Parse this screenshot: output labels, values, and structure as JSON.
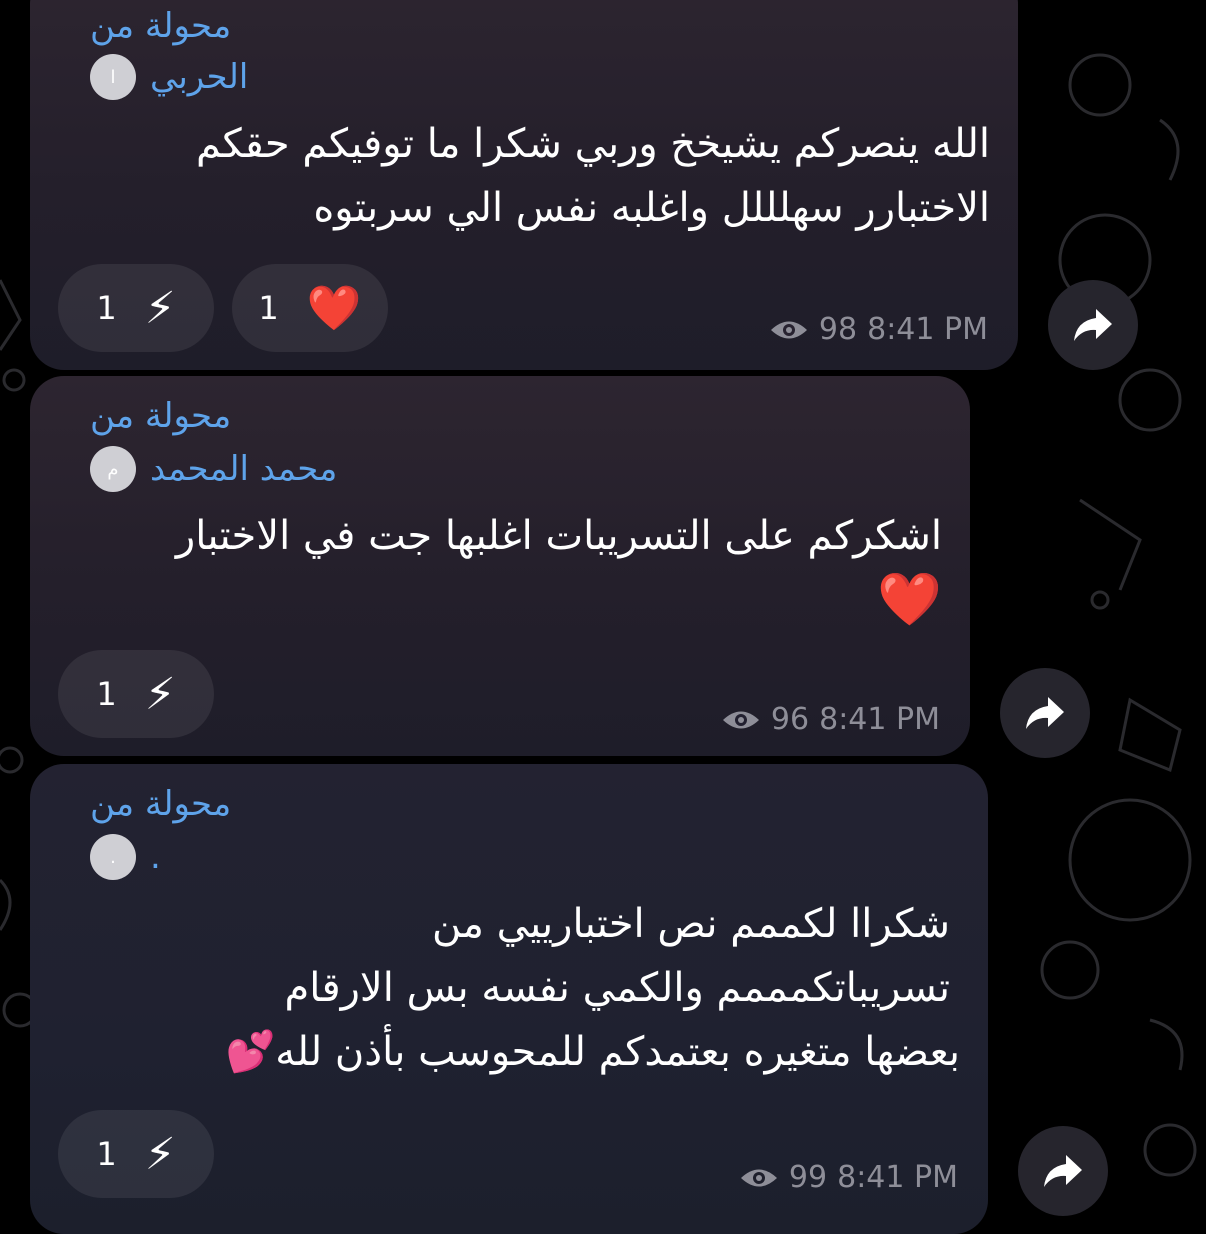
{
  "forwarded_label": "محولة من",
  "messages": [
    {
      "sender": "الحربي",
      "avatar_letter": "ا",
      "text_lines": [
        "الله ينصركم يشيخخ وربي شكرا ما توفيكم حقكم",
        "الاختبارر سهلللل واغلبه نفس الي سربتوه"
      ],
      "reactions": [
        {
          "icon": "lightning-emoji",
          "emoji": "⚡",
          "count": "1"
        },
        {
          "icon": "red-heart-emoji",
          "emoji": "❤️",
          "count": "1"
        }
      ],
      "views": "98",
      "time": "8:41 PM"
    },
    {
      "sender": "محمد المحمد",
      "avatar_letter": "م",
      "text_lines": [
        "اشكركم على التسريبات اغلبها جت في الاختبار",
        "❤️"
      ],
      "reactions": [
        {
          "icon": "lightning-emoji",
          "emoji": "⚡",
          "count": "1"
        }
      ],
      "views": "96",
      "time": "8:41 PM"
    },
    {
      "sender": ".",
      "avatar_letter": ".",
      "text_lines": [
        "شكراا لكممم نص اختبارييي من",
        "تسريباتكمممم والكمي نفسه بس الارقام",
        "بعضها متغيره بعتمدكم للمحوسب بأذن لله💕"
      ],
      "reactions": [
        {
          "icon": "lightning-emoji",
          "emoji": "⚡",
          "count": "1"
        }
      ],
      "views": "99",
      "time": "8:41 PM"
    }
  ],
  "colors": {
    "link_blue": "#5ea3ea",
    "meta_gray": "#8e8e98",
    "bubble": "#262230"
  }
}
